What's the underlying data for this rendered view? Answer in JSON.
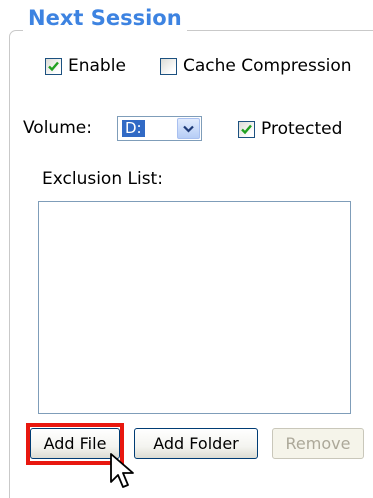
{
  "group": {
    "title": "Next Session"
  },
  "options": {
    "enable": {
      "label": "Enable",
      "checked": true
    },
    "cache_compression": {
      "label": "Cache Compression",
      "checked": false
    }
  },
  "volume": {
    "label": "Volume:",
    "value": "D:"
  },
  "protected": {
    "label": "Protected",
    "checked": true
  },
  "exclusion_list": {
    "label": "Exclusion List:",
    "items": []
  },
  "buttons": {
    "add_file": "Add File",
    "add_folder": "Add Folder",
    "remove": "Remove",
    "remove_enabled": false
  },
  "annotation": {
    "highlight_color": "#e8170f",
    "highlighted": "add-file-button"
  },
  "cursor": {
    "icon": "arrow-pointer-icon"
  },
  "colors": {
    "title": "#3d83e1",
    "check": "#21a121",
    "selection": "#316ac5"
  }
}
